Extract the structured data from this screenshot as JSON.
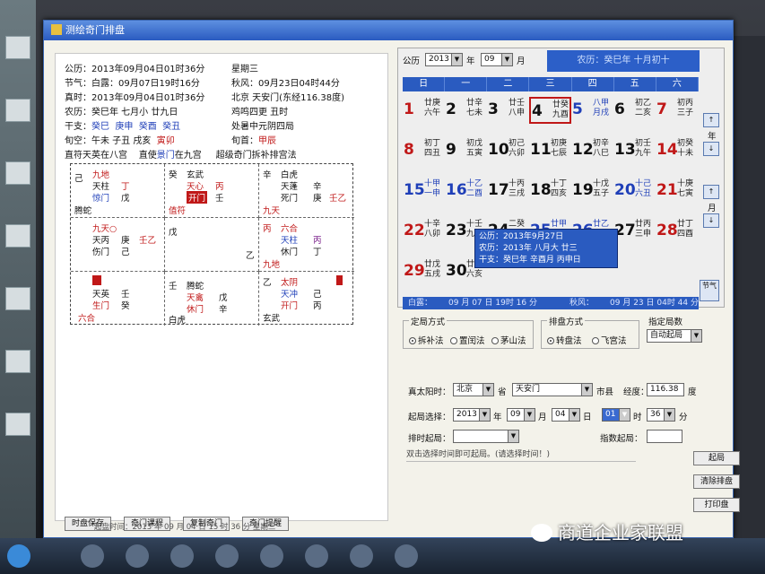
{
  "window": {
    "title": "测绘奇门排盘"
  },
  "info": {
    "l1a": "公历：2013年09月04日01时36分",
    "l1b": "星期三",
    "l2a": "节气：白露：09月07日19时16分",
    "l2b": "秋风：09月23日04时44分",
    "l3a": "真时：2013年09月04日01时36分",
    "l3b": "北京 天安门(东经116.38度)",
    "l4a": "农历：癸巳年  七月小  廿九日",
    "l4b": "鸡鸣四更  丑时",
    "l5a": "干支：",
    "l5b": "癸巳",
    "l5c": "庚申",
    "l5d": "癸酉",
    "l5e": "癸丑",
    "l5f": "处暑中元阴四局",
    "l6a": "旬空：午未   子丑   戌亥",
    "l6b": "寅卯",
    "l6c": "旬首：",
    "l6d": "甲辰",
    "l7a": "直符天英在八宫",
    "l7b": "直使",
    "l7c": "景门",
    "l7d": "在九宫",
    "l7e": "超级奇门拆补排宫法"
  },
  "palaces": [
    {
      "a": "己",
      "b": "九地",
      "c": "天柱",
      "d": "丁",
      "e": "惊门",
      "f": "戊",
      "g": "腾蛇"
    },
    {
      "a": "癸",
      "b": "玄武",
      "c": "天心",
      "d": "丙",
      "e": "开门",
      "f": "壬",
      "g": "值符"
    },
    {
      "a": "辛",
      "b": "白虎",
      "c": "天蓬",
      "d": "辛",
      "e": "死门",
      "f": "庚",
      "g": "九天",
      "h": "壬乙"
    },
    {
      "a": "九天○",
      "b": "天丙",
      "c": "庚",
      "d": "壬乙",
      "e": "伤门",
      "f": "己"
    },
    {
      "a": "戊",
      "b": "乙"
    },
    {
      "a": "丙",
      "b": "六合",
      "c": "天柱",
      "d": "丙",
      "e": "休门",
      "f": "丁",
      "g": "九地"
    },
    {
      "a": "辛",
      "b": "天英",
      "c": "壬",
      "d": "生门",
      "e": "癸",
      "f": "六合"
    },
    {
      "a": "壬",
      "b": "腾蛇",
      "c": "天禽",
      "d": "戊",
      "e": "休门",
      "f": "辛",
      "g": "白虎"
    },
    {
      "a": "乙",
      "b": "太阴",
      "c": "天冲",
      "d": "己",
      "e": "开门",
      "f": "丙",
      "g": "玄武"
    }
  ],
  "left_buttons": [
    "时盘保存",
    "奇门课程",
    "复制奇门",
    "奇门提醒"
  ],
  "left_status": "起盘时间：2013 年 09 月 04 日 15 时 36 分    星期三",
  "calendar": {
    "gongli": "公历",
    "year": "2013",
    "year_unit": "年",
    "month": "09",
    "month_unit": "月",
    "banner": "农历：癸巳年 十月初十",
    "weekdays": [
      "日",
      "一",
      "二",
      "三",
      "四",
      "五",
      "六"
    ],
    "days": [
      {
        "n": "1",
        "l": "廿庚|六午"
      },
      {
        "n": "2",
        "l": "廿辛|七未"
      },
      {
        "n": "3",
        "l": "廿壬|八申"
      },
      {
        "n": "4",
        "l": "廿癸|九酉"
      },
      {
        "n": "5",
        "l": "八甲|月戌"
      },
      {
        "n": "6",
        "l": "初乙|二亥"
      },
      {
        "n": "7",
        "l": "初丙|三子"
      },
      {
        "n": "8",
        "l": "初丁|四丑"
      },
      {
        "n": "9",
        "l": "初戊|五寅"
      },
      {
        "n": "10",
        "l": "初己|六卯"
      },
      {
        "n": "11",
        "l": "初庚|七辰"
      },
      {
        "n": "12",
        "l": "初辛|八巳"
      },
      {
        "n": "13",
        "l": "初壬|九午"
      },
      {
        "n": "14",
        "l": "初癸|十未"
      },
      {
        "n": "15",
        "l": "十甲|一申"
      },
      {
        "n": "16",
        "l": "十乙|二酉"
      },
      {
        "n": "17",
        "l": "十丙|三戌"
      },
      {
        "n": "18",
        "l": "十丁|四亥"
      },
      {
        "n": "19",
        "l": "十戊|五子"
      },
      {
        "n": "20",
        "l": "十己|六丑"
      },
      {
        "n": "21",
        "l": "十庚|七寅"
      },
      {
        "n": "22",
        "l": "十辛|八卯"
      },
      {
        "n": "23",
        "l": "十壬|九辰"
      },
      {
        "n": "24",
        "l": "二癸|十巳"
      },
      {
        "n": "25",
        "l": "廿甲|一午"
      },
      {
        "n": "26",
        "l": "廿乙|二未"
      },
      {
        "n": "27",
        "l": "廿丙|三申"
      },
      {
        "n": "28",
        "l": "廿丁|四酉"
      },
      {
        "n": "29",
        "l": "廿戊|五戌"
      },
      {
        "n": "30",
        "l": "廿己|六亥"
      }
    ],
    "status_a": "白露：",
    "status_b": "09 月 07 日 19时 16 分",
    "status_c": "秋风：",
    "status_d": "09 月 23 日 04时 44 分",
    "popup": [
      "公历：2013年9月27日",
      "农历：2013年 八月大 廿三",
      "干支：癸巳年 辛酉月 丙申日"
    ],
    "side": [
      "↑",
      "年",
      "↓",
      "↑",
      "月",
      "↓",
      "节气"
    ]
  },
  "controls": {
    "g1_title": "定局方式",
    "g1_opts": [
      "拆补法",
      "置闰法",
      "茅山法"
    ],
    "g2_title": "排盘方式",
    "g2_opts": [
      "转盘法",
      "飞宫法"
    ],
    "g3_title": "指定局数",
    "g3_val": "自动起局",
    "row1_a": "真太阳时：",
    "row1_b": "北京",
    "row1_c": "省",
    "row1_d": "天安门",
    "row1_e": "市县",
    "row1_f": "经度：",
    "row1_g": "116.38",
    "row1_h": "度",
    "row2_a": "起局选择：",
    "row2_b": "2013",
    "row2_c": "年",
    "row2_d": "09",
    "row2_e": "月",
    "row2_f": "04",
    "row2_g": "日",
    "row2_h": "01",
    "row2_i": "时",
    "row2_j": "36",
    "row2_k": "分",
    "row3_a": "排时起局：",
    "row3_b": "",
    "row3_c": "指数起局：",
    "row4": "双击选择时间即可起局。(请选择时间！)",
    "buttons": [
      "起局",
      "清除排盘",
      "打印盘"
    ]
  },
  "watermark": "商道企业家联盟"
}
